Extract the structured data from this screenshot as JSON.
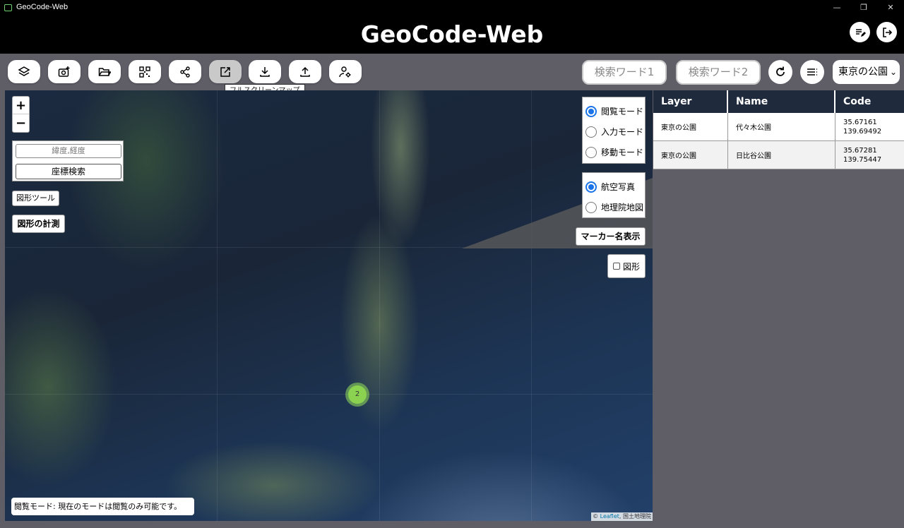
{
  "window": {
    "title": "GeoCode-Web",
    "controls": [
      "—",
      "❐",
      "✕"
    ]
  },
  "header": {
    "title": "GeoCode-Web"
  },
  "toolbar": {
    "tooltip": "フルスクリーンマップ",
    "search1_placeholder": "検索ワード1",
    "search2_placeholder": "検索ワード2",
    "select_value": "東京の公園"
  },
  "map": {
    "zoom_in": "+",
    "zoom_out": "−",
    "coord_placeholder": "緯度,経度",
    "coord_search": "座標検索",
    "shape_tool": "図形ツール",
    "shape_measure": "図形の計測",
    "modes": [
      {
        "label": "閲覧モード",
        "selected": true
      },
      {
        "label": "入力モード",
        "selected": false
      },
      {
        "label": "移動モード",
        "selected": false
      }
    ],
    "layers": [
      {
        "label": "航空写真",
        "selected": true
      },
      {
        "label": "地理院地図",
        "selected": false
      }
    ],
    "marker_names": "マーカー名表示",
    "shape_checkbox": "図形",
    "cluster_count": "2",
    "status": "閲覧モード: 現在のモードは閲覧のみ可能です。",
    "attribution_prefix": "©",
    "attribution_link": "Leaflet",
    "attribution_suffix": ", 国土地理院"
  },
  "table": {
    "headers": [
      "Layer",
      "Name",
      "Code"
    ],
    "rows": [
      {
        "layer": "東京の公園",
        "name": "代々木公園",
        "code1": "35.67161",
        "code2": "139.69492"
      },
      {
        "layer": "東京の公園",
        "name": "日比谷公園",
        "code1": "35.67281",
        "code2": "139.75447"
      }
    ]
  },
  "colors": {
    "accent": "#1a73e8",
    "header_bg": "#000000",
    "table_header": "#1f2a3d",
    "cluster": "#8bd250"
  }
}
